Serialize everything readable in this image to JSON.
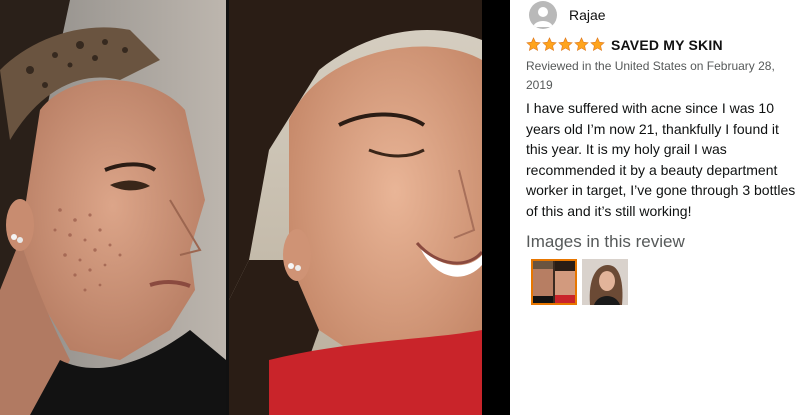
{
  "viewer": {
    "images": [
      {
        "icon": "before-photo"
      },
      {
        "icon": "after-photo"
      }
    ]
  },
  "review": {
    "reviewer_name": "Rajae",
    "avatar_icon": "user-avatar-icon",
    "rating": 5,
    "rating_max": 5,
    "star_color": "#ffa41c",
    "title": "SAVED MY SKIN",
    "meta": "Reviewed in the United States on February 28, 2019",
    "body": "I have suffered with acne since I was 10 years old I’m now 21, thankfully I found it this year. It is my holy grail I was recommended it by a beauty department worker in target, I’ve gone through 3 bottles of this and it’s still working!",
    "images_heading": "Images in this review",
    "thumbnails": [
      {
        "icon": "before-after-thumbnail",
        "selected": true,
        "selected_color": "#e77600"
      },
      {
        "icon": "selfie-thumbnail",
        "selected": false
      }
    ]
  }
}
